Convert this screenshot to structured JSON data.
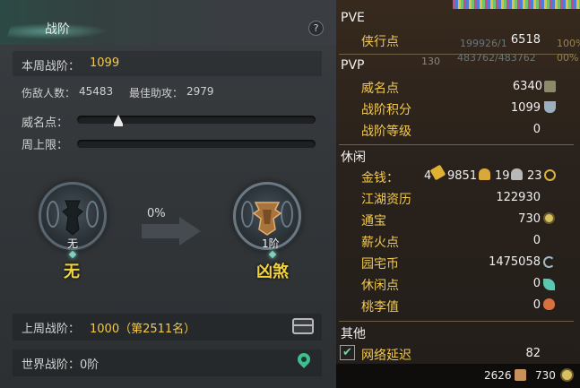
{
  "rank_panel": {
    "title": "战阶",
    "help_glyph": "?",
    "weekly_rank_label": "本周战阶：",
    "weekly_rank_value": "1099",
    "kills_label": "伤敌人数：",
    "kills_value": "45483",
    "best_assist_label": "最佳助攻：",
    "best_assist_value": "2979",
    "prestige_label": "威名点：",
    "weekly_cap_label": "周上限：",
    "current_rank": {
      "level": "无",
      "name": "无"
    },
    "progress_percent_text": "0%",
    "next_rank": {
      "level": "1阶",
      "name": "凶煞"
    },
    "last_week_label": "上周战阶：",
    "last_week_value": "1000（第2511名）",
    "world_rank_label": "世界战阶：",
    "world_rank_value": "0阶",
    "icons": {
      "chest": "chest-icon",
      "location": "location-pin-icon"
    }
  },
  "currency_panel": {
    "sections": {
      "pve": "PVE",
      "pvp": "PVP",
      "leisure": "休闲",
      "other": "其他"
    },
    "pve_items": [
      {
        "label": "侠行点",
        "value": "6518"
      }
    ],
    "pvp_items": [
      {
        "label": "威名点",
        "value": "6340"
      },
      {
        "label": "战阶积分",
        "value": "1099"
      },
      {
        "label": "战阶等级",
        "value": "0"
      }
    ],
    "money": {
      "label": "金钱：",
      "gold": "4",
      "silver": "9851",
      "copper": "19",
      "iron": "23"
    },
    "leisure_items": [
      {
        "label": "江湖资历",
        "value": "122930"
      },
      {
        "label": "通宝",
        "value": "730"
      },
      {
        "label": "薪火点",
        "value": "0"
      },
      {
        "label": "园宅币",
        "value": "1475058"
      },
      {
        "label": "休闲点",
        "value": "0"
      },
      {
        "label": "桃李值",
        "value": "0"
      }
    ],
    "other_items": [
      {
        "label": "网络延迟",
        "value": "82",
        "checked": true
      }
    ],
    "bottom_bar": {
      "value_a": "2626",
      "value_b": "730"
    },
    "background_overlay": {
      "hp_a": "199926/1",
      "hp_b": "483762/483762",
      "pct_a": "100%",
      "pct_b": "00%",
      "level": "130"
    }
  },
  "colors": {
    "gold_text": "#f2c94c",
    "rank_name": "#f2d33a",
    "accent_teal": "#7fd0c0"
  }
}
